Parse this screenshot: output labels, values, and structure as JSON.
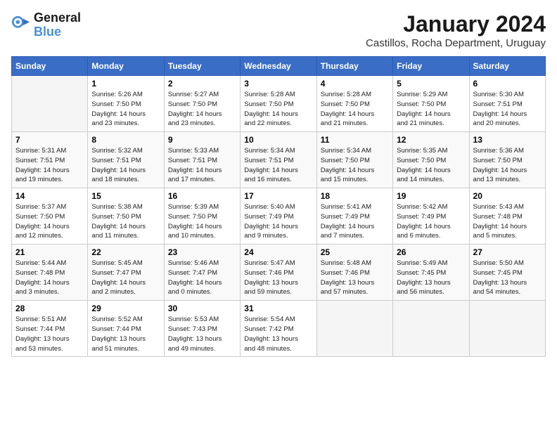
{
  "logo": {
    "line1": "General",
    "line2": "Blue"
  },
  "title": "January 2024",
  "subtitle": "Castillos, Rocha Department, Uruguay",
  "days_header": [
    "Sunday",
    "Monday",
    "Tuesday",
    "Wednesday",
    "Thursday",
    "Friday",
    "Saturday"
  ],
  "weeks": [
    [
      {
        "day": "",
        "info": ""
      },
      {
        "day": "1",
        "info": "Sunrise: 5:26 AM\nSunset: 7:50 PM\nDaylight: 14 hours\nand 23 minutes."
      },
      {
        "day": "2",
        "info": "Sunrise: 5:27 AM\nSunset: 7:50 PM\nDaylight: 14 hours\nand 23 minutes."
      },
      {
        "day": "3",
        "info": "Sunrise: 5:28 AM\nSunset: 7:50 PM\nDaylight: 14 hours\nand 22 minutes."
      },
      {
        "day": "4",
        "info": "Sunrise: 5:28 AM\nSunset: 7:50 PM\nDaylight: 14 hours\nand 21 minutes."
      },
      {
        "day": "5",
        "info": "Sunrise: 5:29 AM\nSunset: 7:50 PM\nDaylight: 14 hours\nand 21 minutes."
      },
      {
        "day": "6",
        "info": "Sunrise: 5:30 AM\nSunset: 7:51 PM\nDaylight: 14 hours\nand 20 minutes."
      }
    ],
    [
      {
        "day": "7",
        "info": "Sunrise: 5:31 AM\nSunset: 7:51 PM\nDaylight: 14 hours\nand 19 minutes."
      },
      {
        "day": "8",
        "info": "Sunrise: 5:32 AM\nSunset: 7:51 PM\nDaylight: 14 hours\nand 18 minutes."
      },
      {
        "day": "9",
        "info": "Sunrise: 5:33 AM\nSunset: 7:51 PM\nDaylight: 14 hours\nand 17 minutes."
      },
      {
        "day": "10",
        "info": "Sunrise: 5:34 AM\nSunset: 7:51 PM\nDaylight: 14 hours\nand 16 minutes."
      },
      {
        "day": "11",
        "info": "Sunrise: 5:34 AM\nSunset: 7:50 PM\nDaylight: 14 hours\nand 15 minutes."
      },
      {
        "day": "12",
        "info": "Sunrise: 5:35 AM\nSunset: 7:50 PM\nDaylight: 14 hours\nand 14 minutes."
      },
      {
        "day": "13",
        "info": "Sunrise: 5:36 AM\nSunset: 7:50 PM\nDaylight: 14 hours\nand 13 minutes."
      }
    ],
    [
      {
        "day": "14",
        "info": "Sunrise: 5:37 AM\nSunset: 7:50 PM\nDaylight: 14 hours\nand 12 minutes."
      },
      {
        "day": "15",
        "info": "Sunrise: 5:38 AM\nSunset: 7:50 PM\nDaylight: 14 hours\nand 11 minutes."
      },
      {
        "day": "16",
        "info": "Sunrise: 5:39 AM\nSunset: 7:50 PM\nDaylight: 14 hours\nand 10 minutes."
      },
      {
        "day": "17",
        "info": "Sunrise: 5:40 AM\nSunset: 7:49 PM\nDaylight: 14 hours\nand 9 minutes."
      },
      {
        "day": "18",
        "info": "Sunrise: 5:41 AM\nSunset: 7:49 PM\nDaylight: 14 hours\nand 7 minutes."
      },
      {
        "day": "19",
        "info": "Sunrise: 5:42 AM\nSunset: 7:49 PM\nDaylight: 14 hours\nand 6 minutes."
      },
      {
        "day": "20",
        "info": "Sunrise: 5:43 AM\nSunset: 7:48 PM\nDaylight: 14 hours\nand 5 minutes."
      }
    ],
    [
      {
        "day": "21",
        "info": "Sunrise: 5:44 AM\nSunset: 7:48 PM\nDaylight: 14 hours\nand 3 minutes."
      },
      {
        "day": "22",
        "info": "Sunrise: 5:45 AM\nSunset: 7:47 PM\nDaylight: 14 hours\nand 2 minutes."
      },
      {
        "day": "23",
        "info": "Sunrise: 5:46 AM\nSunset: 7:47 PM\nDaylight: 14 hours\nand 0 minutes."
      },
      {
        "day": "24",
        "info": "Sunrise: 5:47 AM\nSunset: 7:46 PM\nDaylight: 13 hours\nand 59 minutes."
      },
      {
        "day": "25",
        "info": "Sunrise: 5:48 AM\nSunset: 7:46 PM\nDaylight: 13 hours\nand 57 minutes."
      },
      {
        "day": "26",
        "info": "Sunrise: 5:49 AM\nSunset: 7:45 PM\nDaylight: 13 hours\nand 56 minutes."
      },
      {
        "day": "27",
        "info": "Sunrise: 5:50 AM\nSunset: 7:45 PM\nDaylight: 13 hours\nand 54 minutes."
      }
    ],
    [
      {
        "day": "28",
        "info": "Sunrise: 5:51 AM\nSunset: 7:44 PM\nDaylight: 13 hours\nand 53 minutes."
      },
      {
        "day": "29",
        "info": "Sunrise: 5:52 AM\nSunset: 7:44 PM\nDaylight: 13 hours\nand 51 minutes."
      },
      {
        "day": "30",
        "info": "Sunrise: 5:53 AM\nSunset: 7:43 PM\nDaylight: 13 hours\nand 49 minutes."
      },
      {
        "day": "31",
        "info": "Sunrise: 5:54 AM\nSunset: 7:42 PM\nDaylight: 13 hours\nand 48 minutes."
      },
      {
        "day": "",
        "info": ""
      },
      {
        "day": "",
        "info": ""
      },
      {
        "day": "",
        "info": ""
      }
    ]
  ]
}
